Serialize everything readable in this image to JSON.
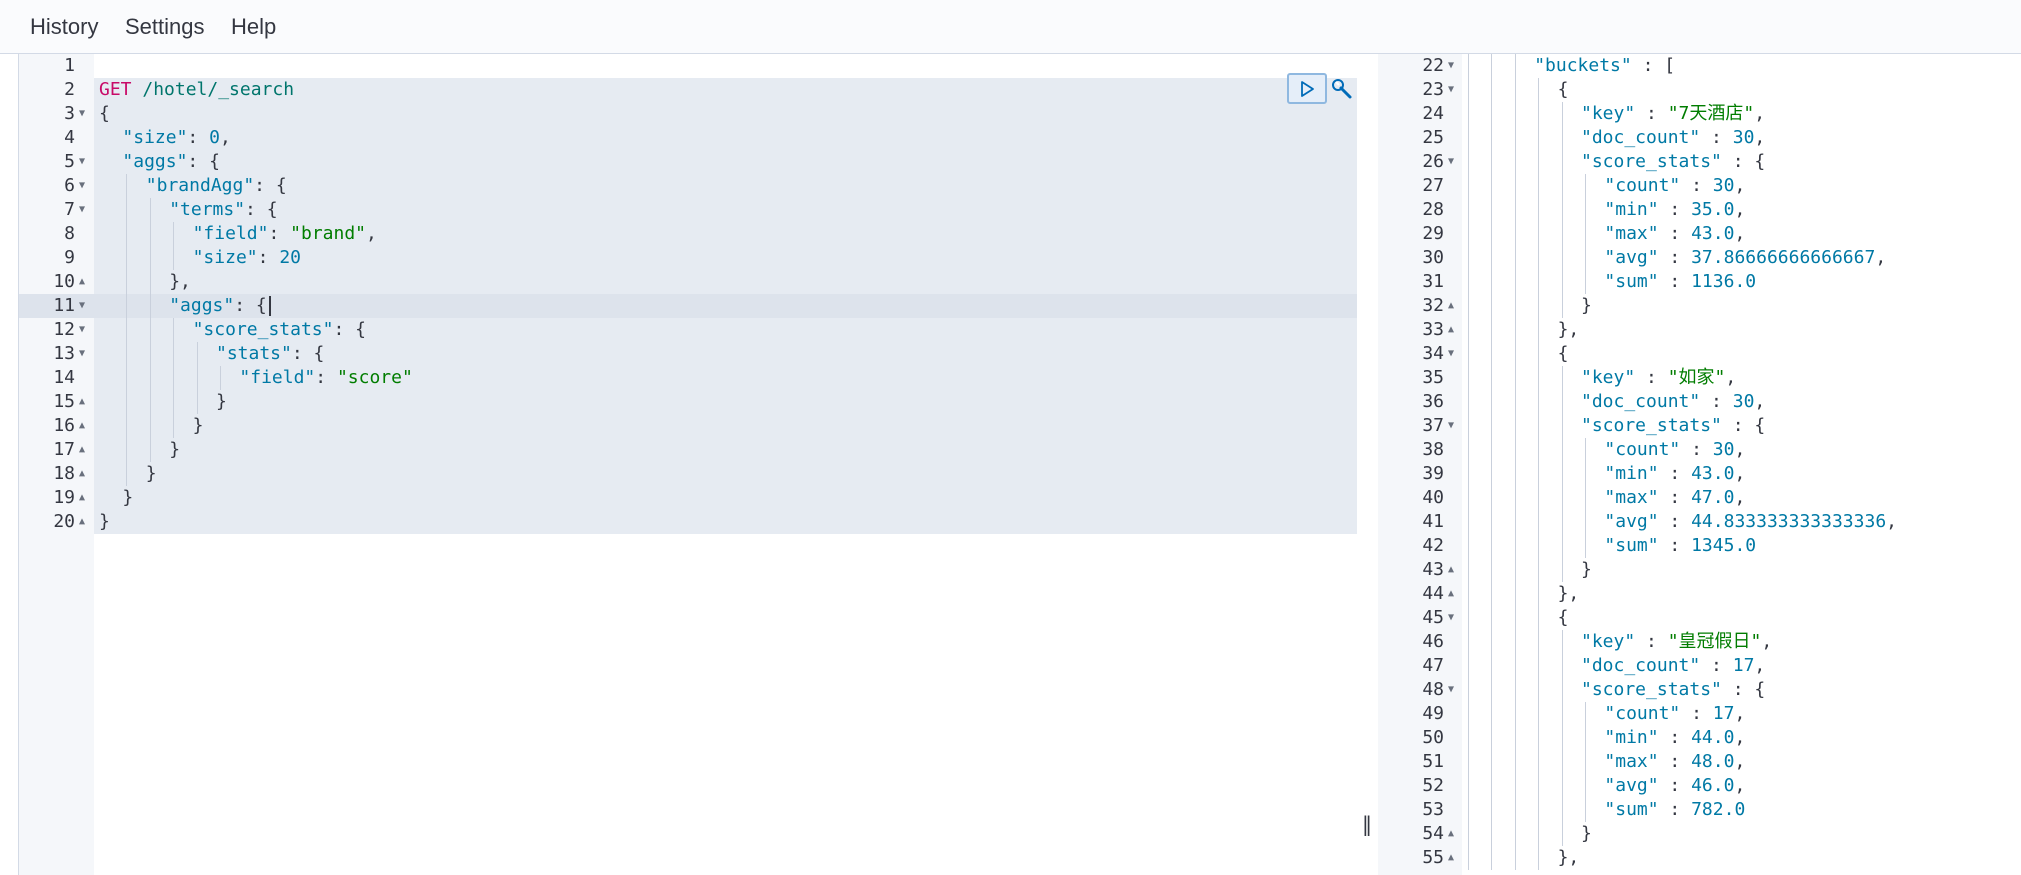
{
  "menu": {
    "history": "History",
    "settings": "Settings",
    "help": "Help"
  },
  "request": {
    "run_label": "▷",
    "lines": [
      {
        "n": "1",
        "fold": "",
        "indent": 0,
        "tokens": []
      },
      {
        "n": "2",
        "fold": "",
        "indent": 0,
        "tokens": [
          [
            "c-method",
            "GET"
          ],
          [
            "c-url",
            " /hotel/_search"
          ]
        ]
      },
      {
        "n": "3",
        "fold": "▼",
        "indent": 0,
        "tokens": [
          [
            "c-punct",
            "{"
          ]
        ]
      },
      {
        "n": "4",
        "fold": "",
        "indent": 1,
        "tokens": [
          [
            "c-key",
            "\"size\""
          ],
          [
            "c-punct",
            ": "
          ],
          [
            "c-num",
            "0"
          ],
          [
            "c-punct",
            ","
          ]
        ]
      },
      {
        "n": "5",
        "fold": "▼",
        "indent": 1,
        "tokens": [
          [
            "c-key",
            "\"aggs\""
          ],
          [
            "c-punct",
            ": {"
          ]
        ]
      },
      {
        "n": "6",
        "fold": "▼",
        "indent": 2,
        "tokens": [
          [
            "c-key",
            "\"brandAgg\""
          ],
          [
            "c-punct",
            ": {"
          ]
        ]
      },
      {
        "n": "7",
        "fold": "▼",
        "indent": 3,
        "tokens": [
          [
            "c-key",
            "\"terms\""
          ],
          [
            "c-punct",
            ": {"
          ]
        ]
      },
      {
        "n": "8",
        "fold": "",
        "indent": 4,
        "tokens": [
          [
            "c-key",
            "\"field\""
          ],
          [
            "c-punct",
            ": "
          ],
          [
            "c-str",
            "\"brand\""
          ],
          [
            "c-punct",
            ","
          ]
        ]
      },
      {
        "n": "9",
        "fold": "",
        "indent": 4,
        "tokens": [
          [
            "c-key",
            "\"size\""
          ],
          [
            "c-punct",
            ": "
          ],
          [
            "c-num",
            "20"
          ]
        ]
      },
      {
        "n": "10",
        "fold": "▲",
        "indent": 3,
        "tokens": [
          [
            "c-punct",
            "},"
          ]
        ]
      },
      {
        "n": "11",
        "fold": "▼",
        "indent": 3,
        "tokens": [
          [
            "c-key",
            "\"aggs\""
          ],
          [
            "c-punct",
            ": {"
          ]
        ]
      },
      {
        "n": "12",
        "fold": "▼",
        "indent": 4,
        "tokens": [
          [
            "c-key",
            "\"score_stats\""
          ],
          [
            "c-punct",
            ": {"
          ]
        ]
      },
      {
        "n": "13",
        "fold": "▼",
        "indent": 5,
        "tokens": [
          [
            "c-key",
            "\"stats\""
          ],
          [
            "c-punct",
            ": {"
          ]
        ]
      },
      {
        "n": "14",
        "fold": "",
        "indent": 6,
        "tokens": [
          [
            "c-key",
            "\"field\""
          ],
          [
            "c-punct",
            ": "
          ],
          [
            "c-str",
            "\"score\""
          ]
        ]
      },
      {
        "n": "15",
        "fold": "▲",
        "indent": 5,
        "tokens": [
          [
            "c-punct",
            "}"
          ]
        ]
      },
      {
        "n": "16",
        "fold": "▲",
        "indent": 4,
        "tokens": [
          [
            "c-punct",
            "}"
          ]
        ]
      },
      {
        "n": "17",
        "fold": "▲",
        "indent": 3,
        "tokens": [
          [
            "c-punct",
            "}"
          ]
        ]
      },
      {
        "n": "18",
        "fold": "▲",
        "indent": 2,
        "tokens": [
          [
            "c-punct",
            "}"
          ]
        ]
      },
      {
        "n": "19",
        "fold": "▲",
        "indent": 1,
        "tokens": [
          [
            "c-punct",
            "}"
          ]
        ]
      },
      {
        "n": "20",
        "fold": "▲",
        "indent": 0,
        "tokens": [
          [
            "c-punct",
            "}"
          ]
        ]
      }
    ]
  },
  "response": {
    "lines": [
      {
        "n": "22",
        "fold": "▼",
        "indent": 3,
        "tokens": [
          [
            "c-key",
            "\"buckets\""
          ],
          [
            "c-punct",
            " : ["
          ]
        ]
      },
      {
        "n": "23",
        "fold": "▼",
        "indent": 4,
        "tokens": [
          [
            "c-punct",
            "{"
          ]
        ]
      },
      {
        "n": "24",
        "fold": "",
        "indent": 5,
        "tokens": [
          [
            "c-key",
            "\"key\""
          ],
          [
            "c-punct",
            " : "
          ],
          [
            "c-str",
            "\"7天酒店\""
          ],
          [
            "c-punct",
            ","
          ]
        ]
      },
      {
        "n": "25",
        "fold": "",
        "indent": 5,
        "tokens": [
          [
            "c-key",
            "\"doc_count\""
          ],
          [
            "c-punct",
            " : "
          ],
          [
            "c-num",
            "30"
          ],
          [
            "c-punct",
            ","
          ]
        ]
      },
      {
        "n": "26",
        "fold": "▼",
        "indent": 5,
        "tokens": [
          [
            "c-key",
            "\"score_stats\""
          ],
          [
            "c-punct",
            " : {"
          ]
        ]
      },
      {
        "n": "27",
        "fold": "",
        "indent": 6,
        "tokens": [
          [
            "c-key",
            "\"count\""
          ],
          [
            "c-punct",
            " : "
          ],
          [
            "c-num",
            "30"
          ],
          [
            "c-punct",
            ","
          ]
        ]
      },
      {
        "n": "28",
        "fold": "",
        "indent": 6,
        "tokens": [
          [
            "c-key",
            "\"min\""
          ],
          [
            "c-punct",
            " : "
          ],
          [
            "c-num",
            "35.0"
          ],
          [
            "c-punct",
            ","
          ]
        ]
      },
      {
        "n": "29",
        "fold": "",
        "indent": 6,
        "tokens": [
          [
            "c-key",
            "\"max\""
          ],
          [
            "c-punct",
            " : "
          ],
          [
            "c-num",
            "43.0"
          ],
          [
            "c-punct",
            ","
          ]
        ]
      },
      {
        "n": "30",
        "fold": "",
        "indent": 6,
        "tokens": [
          [
            "c-key",
            "\"avg\""
          ],
          [
            "c-punct",
            " : "
          ],
          [
            "c-num",
            "37.86666666666667"
          ],
          [
            "c-punct",
            ","
          ]
        ]
      },
      {
        "n": "31",
        "fold": "",
        "indent": 6,
        "tokens": [
          [
            "c-key",
            "\"sum\""
          ],
          [
            "c-punct",
            " : "
          ],
          [
            "c-num",
            "1136.0"
          ]
        ]
      },
      {
        "n": "32",
        "fold": "▲",
        "indent": 5,
        "tokens": [
          [
            "c-punct",
            "}"
          ]
        ]
      },
      {
        "n": "33",
        "fold": "▲",
        "indent": 4,
        "tokens": [
          [
            "c-punct",
            "},"
          ]
        ]
      },
      {
        "n": "34",
        "fold": "▼",
        "indent": 4,
        "tokens": [
          [
            "c-punct",
            "{"
          ]
        ]
      },
      {
        "n": "35",
        "fold": "",
        "indent": 5,
        "tokens": [
          [
            "c-key",
            "\"key\""
          ],
          [
            "c-punct",
            " : "
          ],
          [
            "c-str",
            "\"如家\""
          ],
          [
            "c-punct",
            ","
          ]
        ]
      },
      {
        "n": "36",
        "fold": "",
        "indent": 5,
        "tokens": [
          [
            "c-key",
            "\"doc_count\""
          ],
          [
            "c-punct",
            " : "
          ],
          [
            "c-num",
            "30"
          ],
          [
            "c-punct",
            ","
          ]
        ]
      },
      {
        "n": "37",
        "fold": "▼",
        "indent": 5,
        "tokens": [
          [
            "c-key",
            "\"score_stats\""
          ],
          [
            "c-punct",
            " : {"
          ]
        ]
      },
      {
        "n": "38",
        "fold": "",
        "indent": 6,
        "tokens": [
          [
            "c-key",
            "\"count\""
          ],
          [
            "c-punct",
            " : "
          ],
          [
            "c-num",
            "30"
          ],
          [
            "c-punct",
            ","
          ]
        ]
      },
      {
        "n": "39",
        "fold": "",
        "indent": 6,
        "tokens": [
          [
            "c-key",
            "\"min\""
          ],
          [
            "c-punct",
            " : "
          ],
          [
            "c-num",
            "43.0"
          ],
          [
            "c-punct",
            ","
          ]
        ]
      },
      {
        "n": "40",
        "fold": "",
        "indent": 6,
        "tokens": [
          [
            "c-key",
            "\"max\""
          ],
          [
            "c-punct",
            " : "
          ],
          [
            "c-num",
            "47.0"
          ],
          [
            "c-punct",
            ","
          ]
        ]
      },
      {
        "n": "41",
        "fold": "",
        "indent": 6,
        "tokens": [
          [
            "c-key",
            "\"avg\""
          ],
          [
            "c-punct",
            " : "
          ],
          [
            "c-num",
            "44.833333333333336"
          ],
          [
            "c-punct",
            ","
          ]
        ]
      },
      {
        "n": "42",
        "fold": "",
        "indent": 6,
        "tokens": [
          [
            "c-key",
            "\"sum\""
          ],
          [
            "c-punct",
            " : "
          ],
          [
            "c-num",
            "1345.0"
          ]
        ]
      },
      {
        "n": "43",
        "fold": "▲",
        "indent": 5,
        "tokens": [
          [
            "c-punct",
            "}"
          ]
        ]
      },
      {
        "n": "44",
        "fold": "▲",
        "indent": 4,
        "tokens": [
          [
            "c-punct",
            "},"
          ]
        ]
      },
      {
        "n": "45",
        "fold": "▼",
        "indent": 4,
        "tokens": [
          [
            "c-punct",
            "{"
          ]
        ]
      },
      {
        "n": "46",
        "fold": "",
        "indent": 5,
        "tokens": [
          [
            "c-key",
            "\"key\""
          ],
          [
            "c-punct",
            " : "
          ],
          [
            "c-str",
            "\"皇冠假日\""
          ],
          [
            "c-punct",
            ","
          ]
        ]
      },
      {
        "n": "47",
        "fold": "",
        "indent": 5,
        "tokens": [
          [
            "c-key",
            "\"doc_count\""
          ],
          [
            "c-punct",
            " : "
          ],
          [
            "c-num",
            "17"
          ],
          [
            "c-punct",
            ","
          ]
        ]
      },
      {
        "n": "48",
        "fold": "▼",
        "indent": 5,
        "tokens": [
          [
            "c-key",
            "\"score_stats\""
          ],
          [
            "c-punct",
            " : {"
          ]
        ]
      },
      {
        "n": "49",
        "fold": "",
        "indent": 6,
        "tokens": [
          [
            "c-key",
            "\"count\""
          ],
          [
            "c-punct",
            " : "
          ],
          [
            "c-num",
            "17"
          ],
          [
            "c-punct",
            ","
          ]
        ]
      },
      {
        "n": "50",
        "fold": "",
        "indent": 6,
        "tokens": [
          [
            "c-key",
            "\"min\""
          ],
          [
            "c-punct",
            " : "
          ],
          [
            "c-num",
            "44.0"
          ],
          [
            "c-punct",
            ","
          ]
        ]
      },
      {
        "n": "51",
        "fold": "",
        "indent": 6,
        "tokens": [
          [
            "c-key",
            "\"max\""
          ],
          [
            "c-punct",
            " : "
          ],
          [
            "c-num",
            "48.0"
          ],
          [
            "c-punct",
            ","
          ]
        ]
      },
      {
        "n": "52",
        "fold": "",
        "indent": 6,
        "tokens": [
          [
            "c-key",
            "\"avg\""
          ],
          [
            "c-punct",
            " : "
          ],
          [
            "c-num",
            "46.0"
          ],
          [
            "c-punct",
            ","
          ]
        ]
      },
      {
        "n": "53",
        "fold": "",
        "indent": 6,
        "tokens": [
          [
            "c-key",
            "\"sum\""
          ],
          [
            "c-punct",
            " : "
          ],
          [
            "c-num",
            "782.0"
          ]
        ]
      },
      {
        "n": "54",
        "fold": "▲",
        "indent": 5,
        "tokens": [
          [
            "c-punct",
            "}"
          ]
        ]
      },
      {
        "n": "55",
        "fold": "▲",
        "indent": 4,
        "tokens": [
          [
            "c-punct",
            "},"
          ]
        ]
      }
    ]
  }
}
